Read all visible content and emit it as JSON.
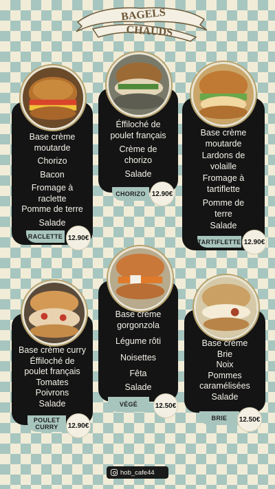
{
  "header": {
    "line1": "BAGELS",
    "line2": "CHAUDS"
  },
  "items": [
    {
      "name": "RACLETTE",
      "price": "12.90€",
      "lines": [
        "Base crème",
        "moutarde",
        "Chorizo",
        "Bacon",
        "Fromage à",
        "raclette",
        "Pomme de terre",
        "Salade"
      ]
    },
    {
      "name": "CHORIZO",
      "price": "12.90€",
      "lines": [
        "Éffiloché de",
        "poulet français",
        "Crème de",
        "chorizo",
        "Salade"
      ]
    },
    {
      "name": "TARTIFLETTE",
      "price": "12.90€",
      "lines": [
        "Base crème",
        "moutarde",
        "Lardons de",
        "volaille",
        "Fromage à",
        "tartiflette",
        "Pomme de",
        "terre",
        "Salade"
      ]
    },
    {
      "name": "POULET CURRY",
      "price": "12.90€",
      "lines": [
        "Base crème curry",
        "Éffiloché de",
        "poulet français",
        "Tomates",
        "Poivrons",
        "Salade"
      ]
    },
    {
      "name": "VÉGÉ",
      "price": "12.50€",
      "lines": [
        "Base crème",
        "gorgonzola",
        "Légume rôti",
        "Noisettes",
        "Fêta",
        "Salade"
      ]
    },
    {
      "name": "BRIE",
      "price": "12.50€",
      "lines": [
        "Base crème",
        "Brie",
        "Noix",
        "Pommes",
        "caramélisées",
        "Salade"
      ]
    }
  ],
  "footer": {
    "instagram": "hob_cafe44"
  },
  "colors": {
    "check": "#a7c6bf",
    "cream": "#f1ecd8",
    "card": "#141414",
    "label": "#a8c5bd"
  }
}
